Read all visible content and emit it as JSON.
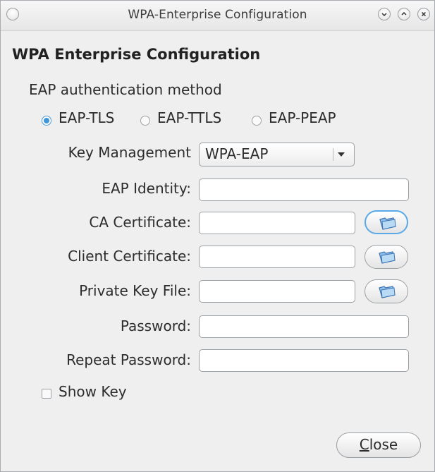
{
  "window": {
    "title": "WPA-Enterprise Configuration",
    "controls": [
      "menu-icon",
      "minimize-icon",
      "maximize-icon",
      "close-icon"
    ]
  },
  "heading": "WPA Enterprise Configuration",
  "eap": {
    "label": "EAP authentication method",
    "options": [
      "EAP-TLS",
      "EAP-TTLS",
      "EAP-PEAP"
    ],
    "selected": "EAP-TLS"
  },
  "key_management": {
    "label": "Key Management",
    "value": "WPA-EAP"
  },
  "fields": {
    "eap_identity": {
      "label": "EAP Identity:",
      "value": ""
    },
    "ca_certificate": {
      "label": "CA Certificate:",
      "value": ""
    },
    "client_certificate": {
      "label": "Client Certificate:",
      "value": ""
    },
    "private_key_file": {
      "label": "Private Key File:",
      "value": ""
    },
    "password": {
      "label": "Password:",
      "value": ""
    },
    "repeat_password": {
      "label": "Repeat Password:",
      "value": ""
    }
  },
  "show_key": {
    "label": "Show Key",
    "checked": false
  },
  "close_button": {
    "label": "Close",
    "mnemonic": "C"
  },
  "colors": {
    "accent": "#3f95d8",
    "window_bg": "#efefef",
    "border": "#9ba0a5"
  }
}
